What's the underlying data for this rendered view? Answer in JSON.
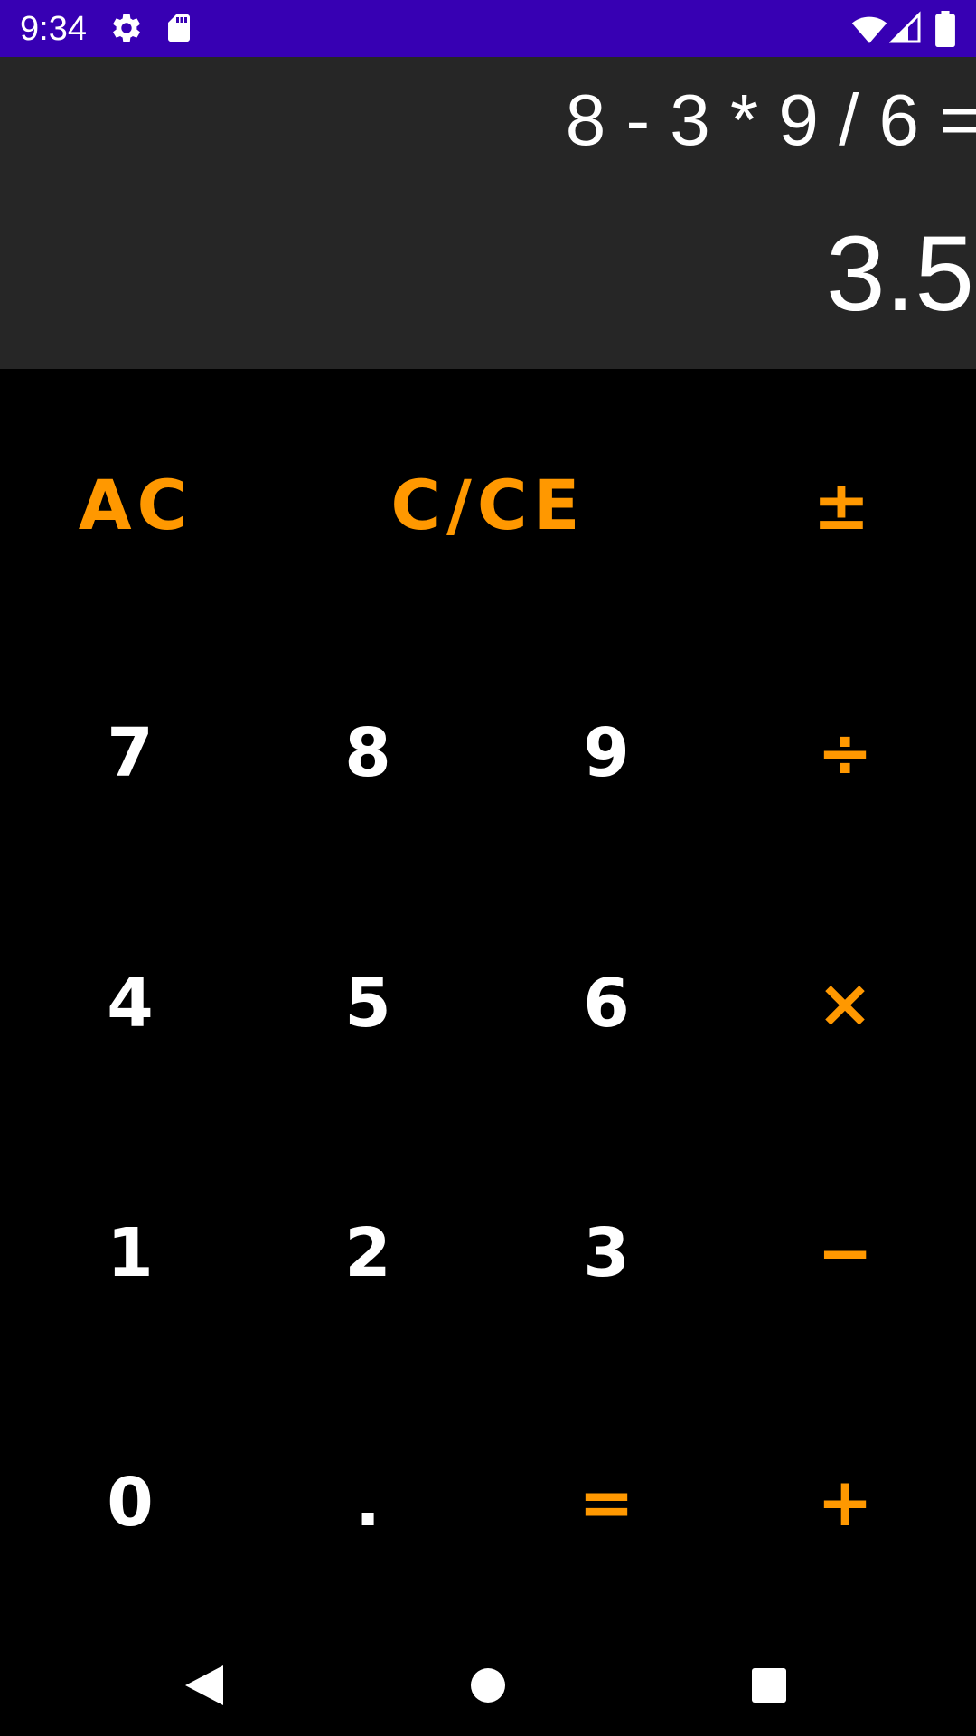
{
  "status_bar": {
    "time": "9:34",
    "background": "#3700b3",
    "left_icons": [
      "gear-icon",
      "sd-card-icon"
    ],
    "right_icons": [
      "wifi-icon",
      "cell-signal-icon",
      "battery-icon"
    ]
  },
  "display": {
    "expression": "8 - 3 * 9 / 6 =",
    "result": "3.5",
    "background": "#262626"
  },
  "keypad": {
    "accent_color": "#ff9800",
    "digit_color": "#ffffff",
    "top_row": {
      "all_clear": "AC",
      "clear_entry": "C/CE",
      "plus_minus": "±"
    },
    "digits": {
      "seven": "7",
      "eight": "8",
      "nine": "9",
      "four": "4",
      "five": "5",
      "six": "6",
      "one": "1",
      "two": "2",
      "three": "3",
      "zero": "0",
      "decimal": "."
    },
    "operators": {
      "divide": "÷",
      "multiply": "×",
      "subtract": "−",
      "equals": "=",
      "add": "+"
    }
  },
  "nav_bar": {
    "icons": [
      "back-icon",
      "home-icon",
      "recents-icon"
    ]
  }
}
